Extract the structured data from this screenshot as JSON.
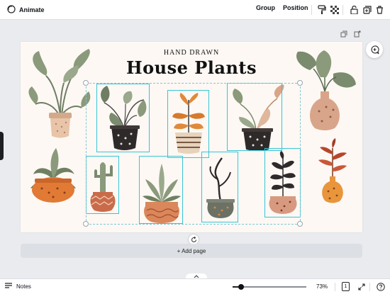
{
  "toolbar": {
    "animate_label": "Animate",
    "group_label": "Group",
    "position_label": "Position",
    "icons": [
      "paint-roller-icon",
      "transparency-icon",
      "unlock-icon",
      "duplicate-icon",
      "trash-icon"
    ]
  },
  "canvas": {
    "page_tool_icons": [
      "duplicate-page-icon",
      "add-page-icon"
    ],
    "comment_icon": "add-comment-icon",
    "rotate_icon": "rotate-icon"
  },
  "design": {
    "subtitle": "HAND DRAWN",
    "title": "House Plants",
    "colors": {
      "background": "#fdf8f4",
      "leaf_green": "#8a9a7b",
      "leaf_dark": "#3b3b3b",
      "pot_orange": "#d9833e",
      "pot_terracotta": "#c96b4a",
      "pot_peach": "#e7b59a",
      "leaf_peach": "#d9a58a",
      "selection": "#38c5d6"
    }
  },
  "add_page_label": "+ Add page",
  "footer": {
    "notes_label": "Notes",
    "zoom_value": "73%",
    "zoom_fraction": 0.12,
    "page_count": "1",
    "icons": [
      "notes-icon",
      "zoom-slider",
      "pages-icon",
      "fullscreen-icon",
      "help-icon"
    ]
  }
}
